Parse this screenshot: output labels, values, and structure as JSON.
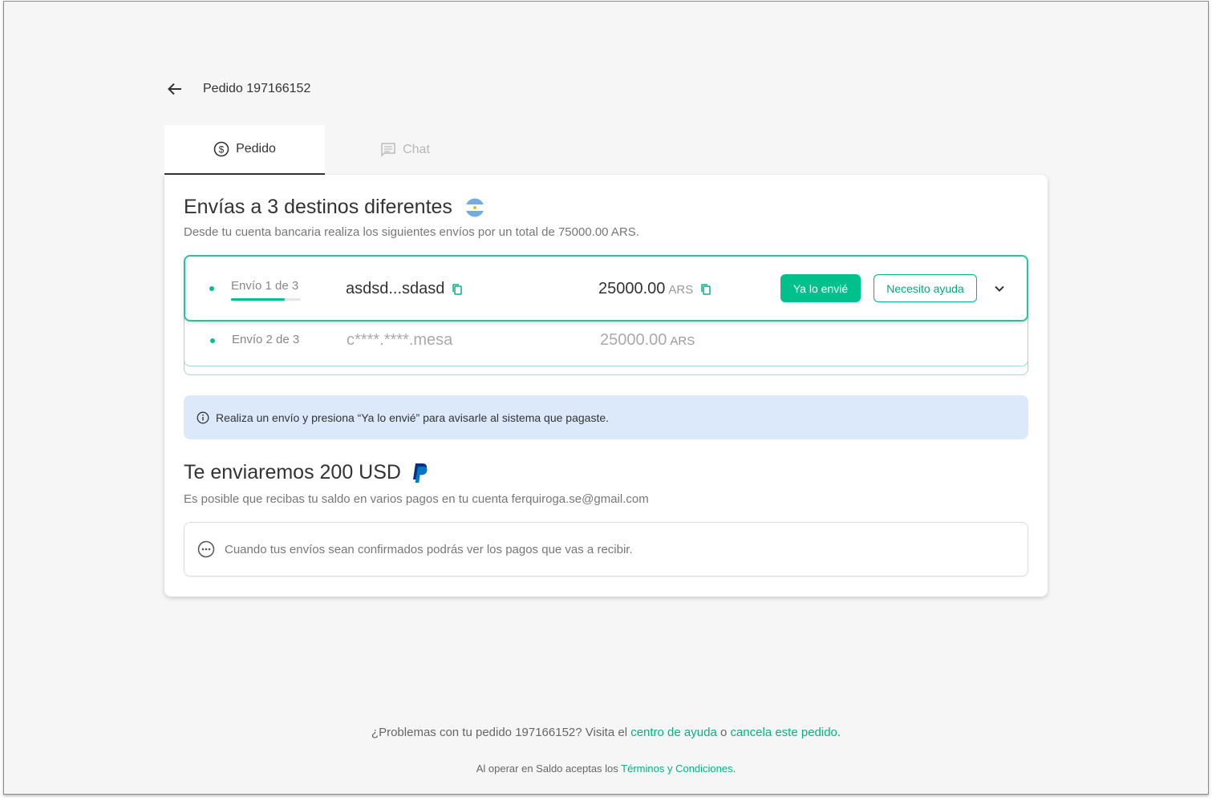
{
  "header": {
    "title": "Pedido 197166152"
  },
  "tabs": [
    {
      "label": "Pedido",
      "icon": "dollar-circle-icon",
      "active": true
    },
    {
      "label": "Chat",
      "icon": "chat-icon",
      "active": false
    }
  ],
  "send": {
    "title": "Envías a 3 destinos diferentes",
    "subtitle": "Desde tu cuenta bancaria realiza los siguientes envíos por un total de 75000.00 ARS.",
    "transfers": [
      {
        "label": "Envío 1 de 3",
        "destination": "asdsd...sdasd",
        "amount": "25000.00",
        "currency": "ARS",
        "progress": 0.77
      },
      {
        "label": "Envío 2 de 3",
        "destination": "c****.****.mesa",
        "amount": "25000.00",
        "currency": "ARS"
      }
    ],
    "sent_button": "Ya lo envié",
    "help_button": "Necesito ayuda",
    "info": "Realiza un envío y presiona “Ya lo envié” para avisarle al sistema que pagaste."
  },
  "receive": {
    "title": "Te enviaremos 200 USD",
    "subtitle": "Es posible que recibas tu saldo en varios pagos en tu cuenta ferquiroga.se@gmail.com",
    "pending": "Cuando tus envíos sean confirmados podrás ver los pagos que vas a recibir."
  },
  "footer": {
    "problems_prefix": "¿Problemas con tu pedido 197166152? Visita el ",
    "help_center_link": "centro de ayuda",
    "or": " o ",
    "cancel_link": "cancela este pedido",
    "period": ".",
    "terms_prefix": "Al operar en Saldo aceptas los ",
    "terms_link": "Términos y Condiciones",
    "terms_period": "."
  },
  "colors": {
    "accent": "#00c08b",
    "info_bg": "#dbe9fb",
    "background": "#f6f6f6"
  }
}
